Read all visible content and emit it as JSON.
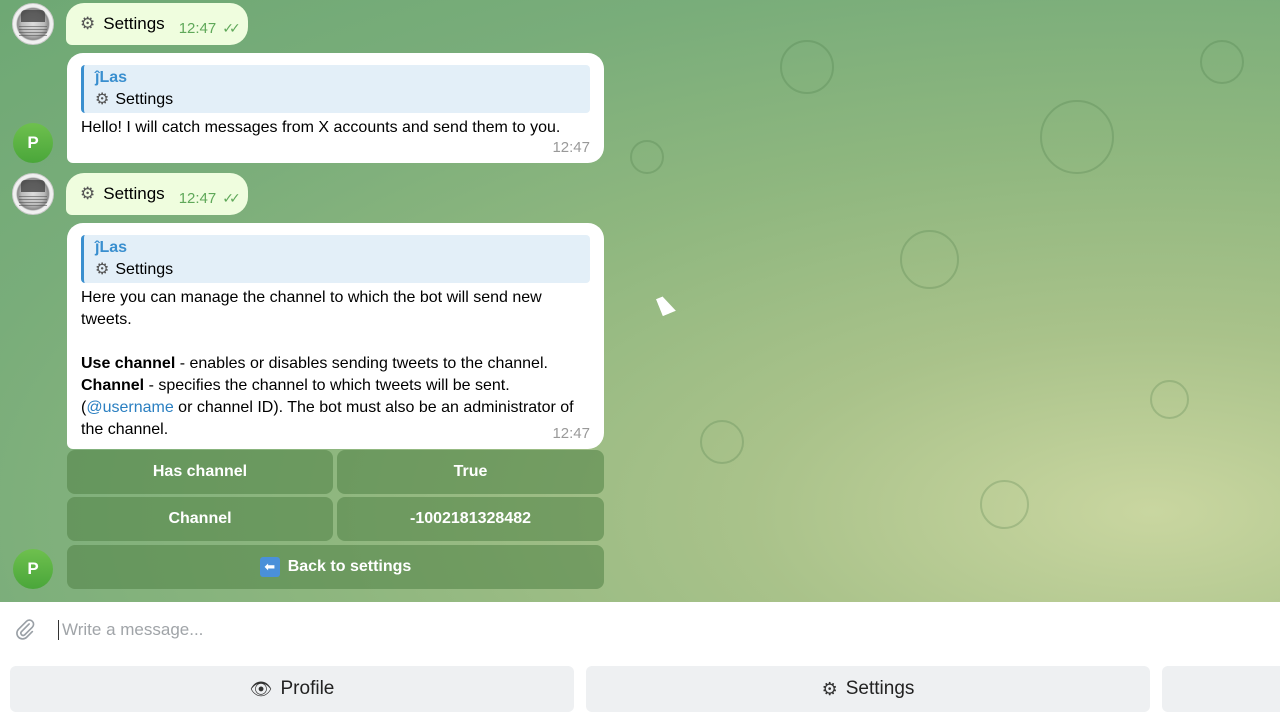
{
  "messages": {
    "out1": {
      "icon": "gear-icon",
      "text": "Settings",
      "time": "12:47"
    },
    "in1": {
      "reply_name": "ĵLas",
      "reply_icon": "gear-icon",
      "reply_text": "Settings",
      "text": "Hello! I will catch messages from X accounts and send them to you.",
      "time": "12:47"
    },
    "out2": {
      "icon": "gear-icon",
      "text": "Settings",
      "time": "12:47"
    },
    "in2": {
      "reply_name": "ĵLas",
      "reply_icon": "gear-icon",
      "reply_text": "Settings",
      "intro": "Here you can manage the channel to which the bot will send new tweets.",
      "use_channel_label": "Use channel",
      "use_channel_desc": " - enables or disables sending tweets to the channel.",
      "channel_label": "Channel",
      "channel_desc": " - specifies the channel to which tweets will be sent.",
      "paren_open": "(",
      "username_link": "@username",
      "rest": " or channel ID). The bot must also be an administrator of the channel.",
      "time": "12:47"
    }
  },
  "avatars": {
    "bot_letter": "P"
  },
  "keyboard": {
    "has_channel_label": "Has channel",
    "has_channel_value": "True",
    "channel_label": "Channel",
    "channel_value": "-1002181328482",
    "back_icon": "back-arrow-icon",
    "back_label": "Back to settings"
  },
  "composer": {
    "placeholder": "Write a message..."
  },
  "reply_keyboard": {
    "profile_icon": "eye-icon",
    "profile_label": "Profile",
    "settings_icon": "gear-icon",
    "settings_label": "Settings"
  }
}
